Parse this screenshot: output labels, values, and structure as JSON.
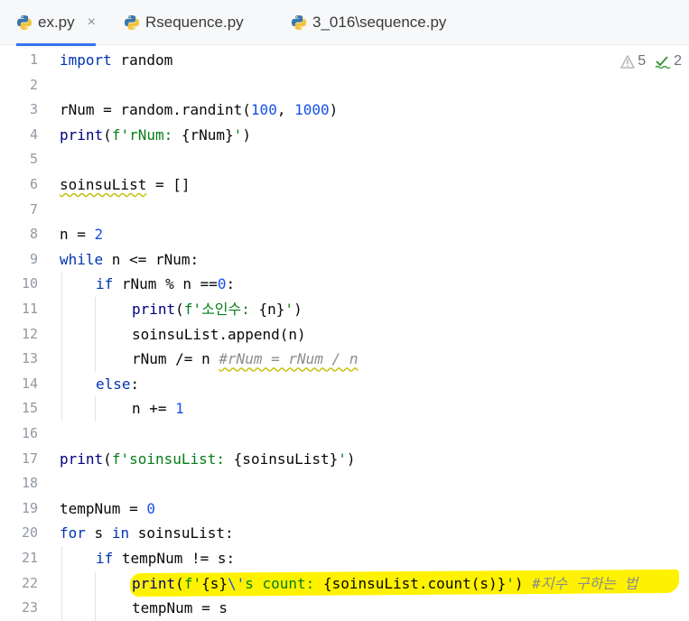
{
  "tabs": [
    {
      "label": "ex.py",
      "active": true,
      "closable": true,
      "icon": "python-icon"
    },
    {
      "label": "Rsequence.py",
      "active": false,
      "closable": false,
      "icon": "python-icon"
    },
    {
      "label": "3_016\\sequence.py",
      "active": false,
      "closable": false,
      "icon": "python-icon"
    }
  ],
  "close_glyph": "×",
  "inspection": {
    "warnings": "5",
    "typos": "2",
    "warning_icon": "warning-triangle-icon",
    "typo_icon": "spellcheck-icon",
    "colors": {
      "warning": "#b8b8b8",
      "typo": "#3d9a3d"
    }
  },
  "editor": {
    "colors": {
      "keyword": "#0033b3",
      "number": "#1750eb",
      "string": "#067d17",
      "comment": "#8c8c8c",
      "line_number": "#9099a3",
      "highlight_marker": "#fff200",
      "active_tab_underline": "#3574f0"
    },
    "lines": [
      {
        "n": "1",
        "indent": 0,
        "tokens": [
          {
            "t": "import",
            "c": "kw"
          },
          {
            "t": " random"
          }
        ]
      },
      {
        "n": "2",
        "indent": 0,
        "tokens": []
      },
      {
        "n": "3",
        "indent": 0,
        "tokens": [
          {
            "t": "rNum = random.randint("
          },
          {
            "t": "100",
            "c": "num"
          },
          {
            "t": ", "
          },
          {
            "t": "1000",
            "c": "num"
          },
          {
            "t": ")"
          }
        ]
      },
      {
        "n": "4",
        "indent": 0,
        "tokens": [
          {
            "t": "print",
            "c": "bi"
          },
          {
            "t": "("
          },
          {
            "t": "f'rNum: ",
            "c": "str"
          },
          {
            "t": "{rNum}"
          },
          {
            "t": "'",
            "c": "str"
          },
          {
            "t": ")"
          }
        ]
      },
      {
        "n": "5",
        "indent": 0,
        "tokens": []
      },
      {
        "n": "6",
        "indent": 0,
        "tokens": [
          {
            "t": "soinsuList",
            "c": "squiggle"
          },
          {
            "t": " = []"
          }
        ]
      },
      {
        "n": "7",
        "indent": 0,
        "tokens": []
      },
      {
        "n": "8",
        "indent": 0,
        "tokens": [
          {
            "t": "n = "
          },
          {
            "t": "2",
            "c": "num"
          }
        ]
      },
      {
        "n": "9",
        "indent": 0,
        "tokens": [
          {
            "t": "while",
            "c": "kw"
          },
          {
            "t": " n <= rNum:"
          }
        ]
      },
      {
        "n": "10",
        "indent": 1,
        "tokens": [
          {
            "t": "if",
            "c": "kw"
          },
          {
            "t": " rNum % n =="
          },
          {
            "t": "0",
            "c": "num"
          },
          {
            "t": ":"
          }
        ]
      },
      {
        "n": "11",
        "indent": 2,
        "tokens": [
          {
            "t": "print",
            "c": "bi"
          },
          {
            "t": "("
          },
          {
            "t": "f'소인수: ",
            "c": "str"
          },
          {
            "t": "{n}"
          },
          {
            "t": "'",
            "c": "str"
          },
          {
            "t": ")"
          }
        ]
      },
      {
        "n": "12",
        "indent": 2,
        "tokens": [
          {
            "t": "soinsuList.append(n)"
          }
        ]
      },
      {
        "n": "13",
        "indent": 2,
        "tokens": [
          {
            "t": "rNum /= n "
          },
          {
            "t": "#rNum = rNum / n",
            "c": "cmt squiggle"
          }
        ]
      },
      {
        "n": "14",
        "indent": 1,
        "tokens": [
          {
            "t": "else",
            "c": "kw"
          },
          {
            "t": ":"
          }
        ]
      },
      {
        "n": "15",
        "indent": 2,
        "tokens": [
          {
            "t": "n += "
          },
          {
            "t": "1",
            "c": "num"
          }
        ]
      },
      {
        "n": "16",
        "indent": 0,
        "tokens": []
      },
      {
        "n": "17",
        "indent": 0,
        "tokens": [
          {
            "t": "print",
            "c": "bi"
          },
          {
            "t": "("
          },
          {
            "t": "f'soinsuList: ",
            "c": "str"
          },
          {
            "t": "{soinsuList}"
          },
          {
            "t": "'",
            "c": "str"
          },
          {
            "t": ")"
          }
        ]
      },
      {
        "n": "18",
        "indent": 0,
        "tokens": []
      },
      {
        "n": "19",
        "indent": 0,
        "tokens": [
          {
            "t": "tempNum = "
          },
          {
            "t": "0",
            "c": "num"
          }
        ]
      },
      {
        "n": "20",
        "indent": 0,
        "tokens": [
          {
            "t": "for",
            "c": "kw"
          },
          {
            "t": " s "
          },
          {
            "t": "in",
            "c": "kw"
          },
          {
            "t": " soinsuList:"
          }
        ]
      },
      {
        "n": "21",
        "indent": 1,
        "tokens": [
          {
            "t": "if",
            "c": "kw"
          },
          {
            "t": " tempNum != s:"
          }
        ]
      },
      {
        "n": "22",
        "indent": 2,
        "tokens": [
          {
            "t": "print",
            "c": "bi"
          },
          {
            "t": "("
          },
          {
            "t": "f'",
            "c": "str"
          },
          {
            "t": "{s}"
          },
          {
            "t": "\\'",
            "c": "num"
          },
          {
            "t": "s count: ",
            "c": "str"
          },
          {
            "t": "{soinsuList.count(s)}"
          },
          {
            "t": "'",
            "c": "str"
          },
          {
            "t": ") "
          },
          {
            "t": "#지수 구하는 법",
            "c": "cmt"
          }
        ]
      },
      {
        "n": "23",
        "indent": 2,
        "tokens": [
          {
            "t": "tempNum = s"
          }
        ]
      }
    ]
  }
}
